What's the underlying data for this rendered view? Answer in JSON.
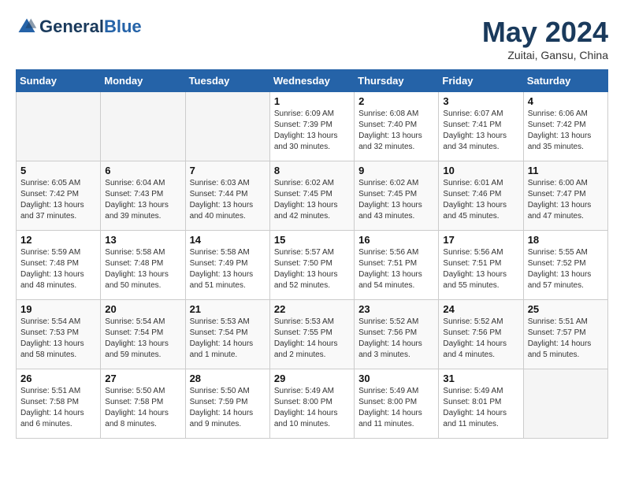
{
  "header": {
    "logo_general": "General",
    "logo_blue": "Blue",
    "month": "May 2024",
    "location": "Zuitai, Gansu, China"
  },
  "weekdays": [
    "Sunday",
    "Monday",
    "Tuesday",
    "Wednesday",
    "Thursday",
    "Friday",
    "Saturday"
  ],
  "weeks": [
    [
      {
        "day": "",
        "info": ""
      },
      {
        "day": "",
        "info": ""
      },
      {
        "day": "",
        "info": ""
      },
      {
        "day": "1",
        "info": "Sunrise: 6:09 AM\nSunset: 7:39 PM\nDaylight: 13 hours\nand 30 minutes."
      },
      {
        "day": "2",
        "info": "Sunrise: 6:08 AM\nSunset: 7:40 PM\nDaylight: 13 hours\nand 32 minutes."
      },
      {
        "day": "3",
        "info": "Sunrise: 6:07 AM\nSunset: 7:41 PM\nDaylight: 13 hours\nand 34 minutes."
      },
      {
        "day": "4",
        "info": "Sunrise: 6:06 AM\nSunset: 7:42 PM\nDaylight: 13 hours\nand 35 minutes."
      }
    ],
    [
      {
        "day": "5",
        "info": "Sunrise: 6:05 AM\nSunset: 7:42 PM\nDaylight: 13 hours\nand 37 minutes."
      },
      {
        "day": "6",
        "info": "Sunrise: 6:04 AM\nSunset: 7:43 PM\nDaylight: 13 hours\nand 39 minutes."
      },
      {
        "day": "7",
        "info": "Sunrise: 6:03 AM\nSunset: 7:44 PM\nDaylight: 13 hours\nand 40 minutes."
      },
      {
        "day": "8",
        "info": "Sunrise: 6:02 AM\nSunset: 7:45 PM\nDaylight: 13 hours\nand 42 minutes."
      },
      {
        "day": "9",
        "info": "Sunrise: 6:02 AM\nSunset: 7:45 PM\nDaylight: 13 hours\nand 43 minutes."
      },
      {
        "day": "10",
        "info": "Sunrise: 6:01 AM\nSunset: 7:46 PM\nDaylight: 13 hours\nand 45 minutes."
      },
      {
        "day": "11",
        "info": "Sunrise: 6:00 AM\nSunset: 7:47 PM\nDaylight: 13 hours\nand 47 minutes."
      }
    ],
    [
      {
        "day": "12",
        "info": "Sunrise: 5:59 AM\nSunset: 7:48 PM\nDaylight: 13 hours\nand 48 minutes."
      },
      {
        "day": "13",
        "info": "Sunrise: 5:58 AM\nSunset: 7:48 PM\nDaylight: 13 hours\nand 50 minutes."
      },
      {
        "day": "14",
        "info": "Sunrise: 5:58 AM\nSunset: 7:49 PM\nDaylight: 13 hours\nand 51 minutes."
      },
      {
        "day": "15",
        "info": "Sunrise: 5:57 AM\nSunset: 7:50 PM\nDaylight: 13 hours\nand 52 minutes."
      },
      {
        "day": "16",
        "info": "Sunrise: 5:56 AM\nSunset: 7:51 PM\nDaylight: 13 hours\nand 54 minutes."
      },
      {
        "day": "17",
        "info": "Sunrise: 5:56 AM\nSunset: 7:51 PM\nDaylight: 13 hours\nand 55 minutes."
      },
      {
        "day": "18",
        "info": "Sunrise: 5:55 AM\nSunset: 7:52 PM\nDaylight: 13 hours\nand 57 minutes."
      }
    ],
    [
      {
        "day": "19",
        "info": "Sunrise: 5:54 AM\nSunset: 7:53 PM\nDaylight: 13 hours\nand 58 minutes."
      },
      {
        "day": "20",
        "info": "Sunrise: 5:54 AM\nSunset: 7:54 PM\nDaylight: 13 hours\nand 59 minutes."
      },
      {
        "day": "21",
        "info": "Sunrise: 5:53 AM\nSunset: 7:54 PM\nDaylight: 14 hours\nand 1 minute."
      },
      {
        "day": "22",
        "info": "Sunrise: 5:53 AM\nSunset: 7:55 PM\nDaylight: 14 hours\nand 2 minutes."
      },
      {
        "day": "23",
        "info": "Sunrise: 5:52 AM\nSunset: 7:56 PM\nDaylight: 14 hours\nand 3 minutes."
      },
      {
        "day": "24",
        "info": "Sunrise: 5:52 AM\nSunset: 7:56 PM\nDaylight: 14 hours\nand 4 minutes."
      },
      {
        "day": "25",
        "info": "Sunrise: 5:51 AM\nSunset: 7:57 PM\nDaylight: 14 hours\nand 5 minutes."
      }
    ],
    [
      {
        "day": "26",
        "info": "Sunrise: 5:51 AM\nSunset: 7:58 PM\nDaylight: 14 hours\nand 6 minutes."
      },
      {
        "day": "27",
        "info": "Sunrise: 5:50 AM\nSunset: 7:58 PM\nDaylight: 14 hours\nand 8 minutes."
      },
      {
        "day": "28",
        "info": "Sunrise: 5:50 AM\nSunset: 7:59 PM\nDaylight: 14 hours\nand 9 minutes."
      },
      {
        "day": "29",
        "info": "Sunrise: 5:49 AM\nSunset: 8:00 PM\nDaylight: 14 hours\nand 10 minutes."
      },
      {
        "day": "30",
        "info": "Sunrise: 5:49 AM\nSunset: 8:00 PM\nDaylight: 14 hours\nand 11 minutes."
      },
      {
        "day": "31",
        "info": "Sunrise: 5:49 AM\nSunset: 8:01 PM\nDaylight: 14 hours\nand 11 minutes."
      },
      {
        "day": "",
        "info": ""
      }
    ]
  ]
}
